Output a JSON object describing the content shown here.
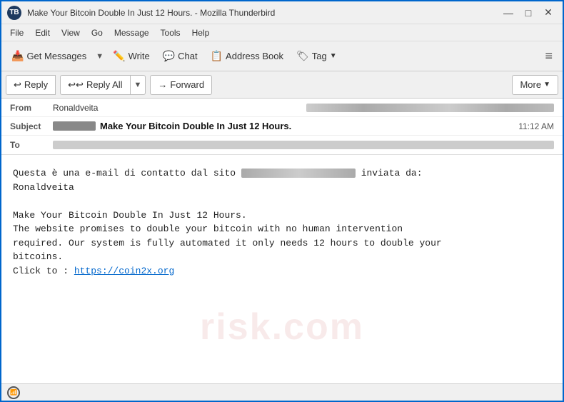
{
  "window": {
    "title": "Make Your Bitcoin Double In Just 12 Hours. - Mozilla Thunderbird",
    "icon_label": "TB"
  },
  "title_controls": {
    "minimize": "—",
    "maximize": "□",
    "close": "✕"
  },
  "menu": {
    "items": [
      "File",
      "Edit",
      "View",
      "Go",
      "Message",
      "Tools",
      "Help"
    ]
  },
  "toolbar": {
    "get_messages_label": "Get Messages",
    "write_label": "Write",
    "chat_label": "Chat",
    "address_book_label": "Address Book",
    "tag_label": "Tag",
    "hamburger": "≡"
  },
  "action_bar": {
    "reply_label": "Reply",
    "reply_all_label": "Reply All",
    "forward_label": "Forward",
    "more_label": "More"
  },
  "email": {
    "from_label": "From",
    "from_name": "Ronaldveita",
    "from_email_blurred": true,
    "subject_label": "Subject",
    "subject_prefix_blurred": true,
    "subject_text": "Make Your Bitcoin Double In Just 12 Hours.",
    "timestamp": "11:12 AM",
    "to_label": "To",
    "to_email_blurred": true
  },
  "body": {
    "line1": "Questa è una e-mail di contatto dal sito",
    "line1_blurred": true,
    "line1_suffix": "inviata da:",
    "line2": "Ronaldveita",
    "line3": "",
    "line4": "Make Your Bitcoin Double In Just 12 Hours.",
    "line5": "The website promises to double your bitcoin with no human intervention",
    "line6": "required. Our system is fully automated it only needs 12 hours to double your",
    "line7": "bitcoins.",
    "line8_prefix": "Click to : ",
    "link_text": "https://coin2x.org",
    "link_url": "https://coin2x.org"
  },
  "watermark": {
    "text": "risk.com"
  },
  "status": {
    "icon_text": "((·))"
  }
}
